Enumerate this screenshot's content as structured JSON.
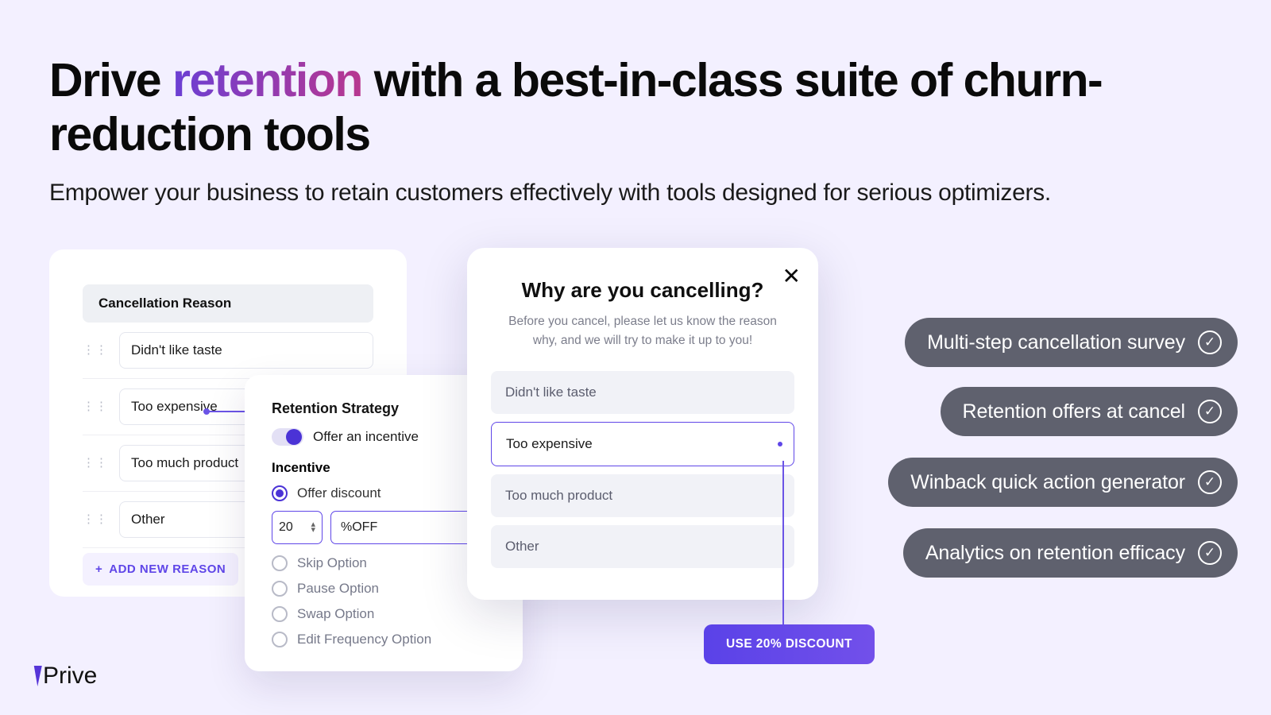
{
  "heading": {
    "before": "Drive ",
    "accent": "retention",
    "after": " with a best-in-class suite of churn-reduction tools"
  },
  "subheading": "Empower your business to retain customers effectively with tools designed for serious optimizers.",
  "reasons": {
    "header": "Cancellation Reason",
    "items": [
      "Didn't like taste",
      "Too expensive",
      "Too much product",
      "Other"
    ],
    "add_label": "ADD NEW REASON"
  },
  "strategy": {
    "title": "Retention Strategy",
    "toggle_label": "Offer an incentive",
    "incentive_label": "Incentive",
    "discount_value": "20",
    "discount_unit": "%OFF",
    "options": [
      "Offer discount",
      "Skip Option",
      "Pause Option",
      "Swap Option",
      "Edit Frequency Option"
    ],
    "selected_index": 0
  },
  "modal": {
    "title": "Why are you cancelling?",
    "subtitle": "Before you cancel, please let us know the reason why, and we will try to make it up to you!",
    "options": [
      "Didn't like taste",
      "Too expensive",
      "Too much product",
      "Other"
    ],
    "selected_index": 1
  },
  "cta_label": "USE 20% DISCOUNT",
  "pills": [
    "Multi-step cancellation survey",
    "Retention offers at cancel",
    "Winback quick action generator",
    "Analytics on retention efficacy"
  ],
  "logo_text": "Prive"
}
